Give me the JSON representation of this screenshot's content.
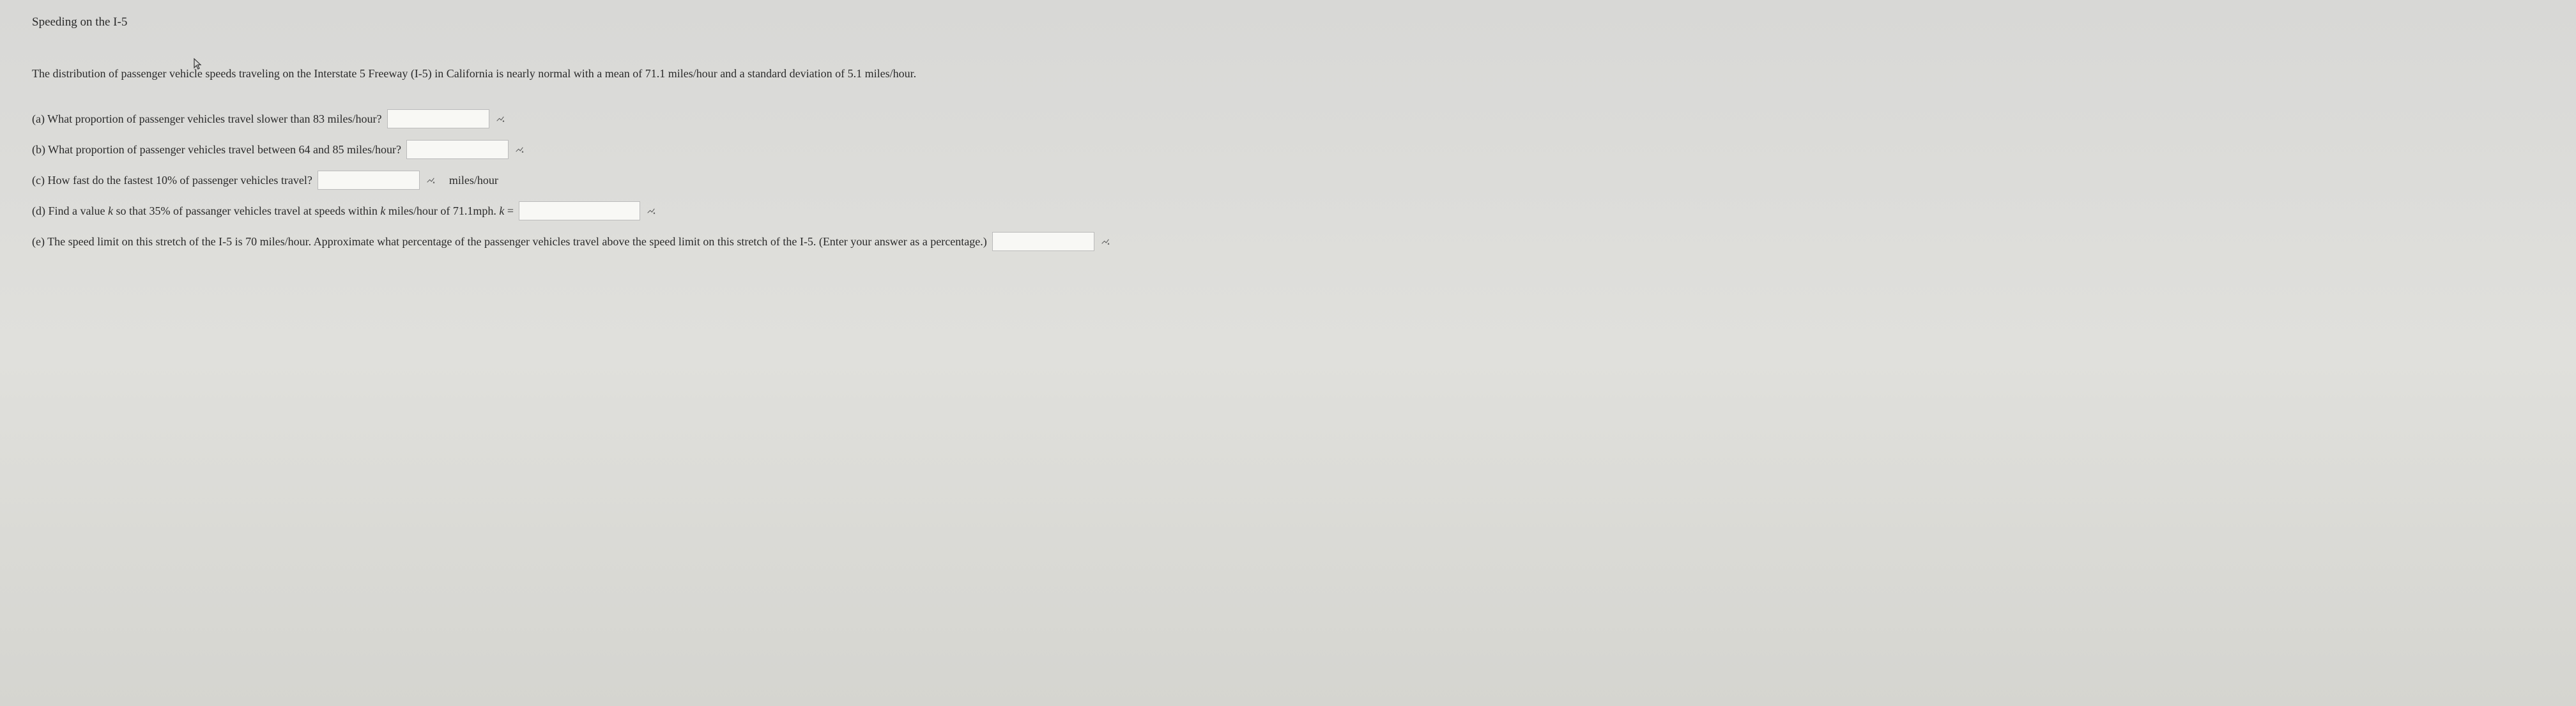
{
  "title": "Speeding on the I-5",
  "description": "The distribution of passenger vehicle speeds traveling on the Interstate 5 Freeway (I-5) in California is nearly normal with a mean of 71.1 miles/hour and a standard deviation of 5.1 miles/hour.",
  "questions": {
    "a": {
      "text": "(a) What proportion of passenger vehicles travel slower than 83 miles/hour?"
    },
    "b": {
      "text": "(b) What proportion of passenger vehicles travel between 64 and 85 miles/hour?"
    },
    "c": {
      "text": "(c) How fast do the fastest 10% of passenger vehicles travel?",
      "unit": "miles/hour"
    },
    "d": {
      "prefix": "(d) Find a value ",
      "k1": "k",
      "middle": " so that 35% of passanger vehicles travel at speeds within ",
      "k2": "k",
      "suffix": " miles/hour of 71.1mph. ",
      "k3": "k",
      "equals": " ="
    },
    "e": {
      "text": "(e) The speed limit on this stretch of the I-5 is 70 miles/hour. Approximate what percentage of the passenger vehicles travel above the speed limit on this stretch of the I-5. (Enter your answer as a percentage.)"
    }
  }
}
